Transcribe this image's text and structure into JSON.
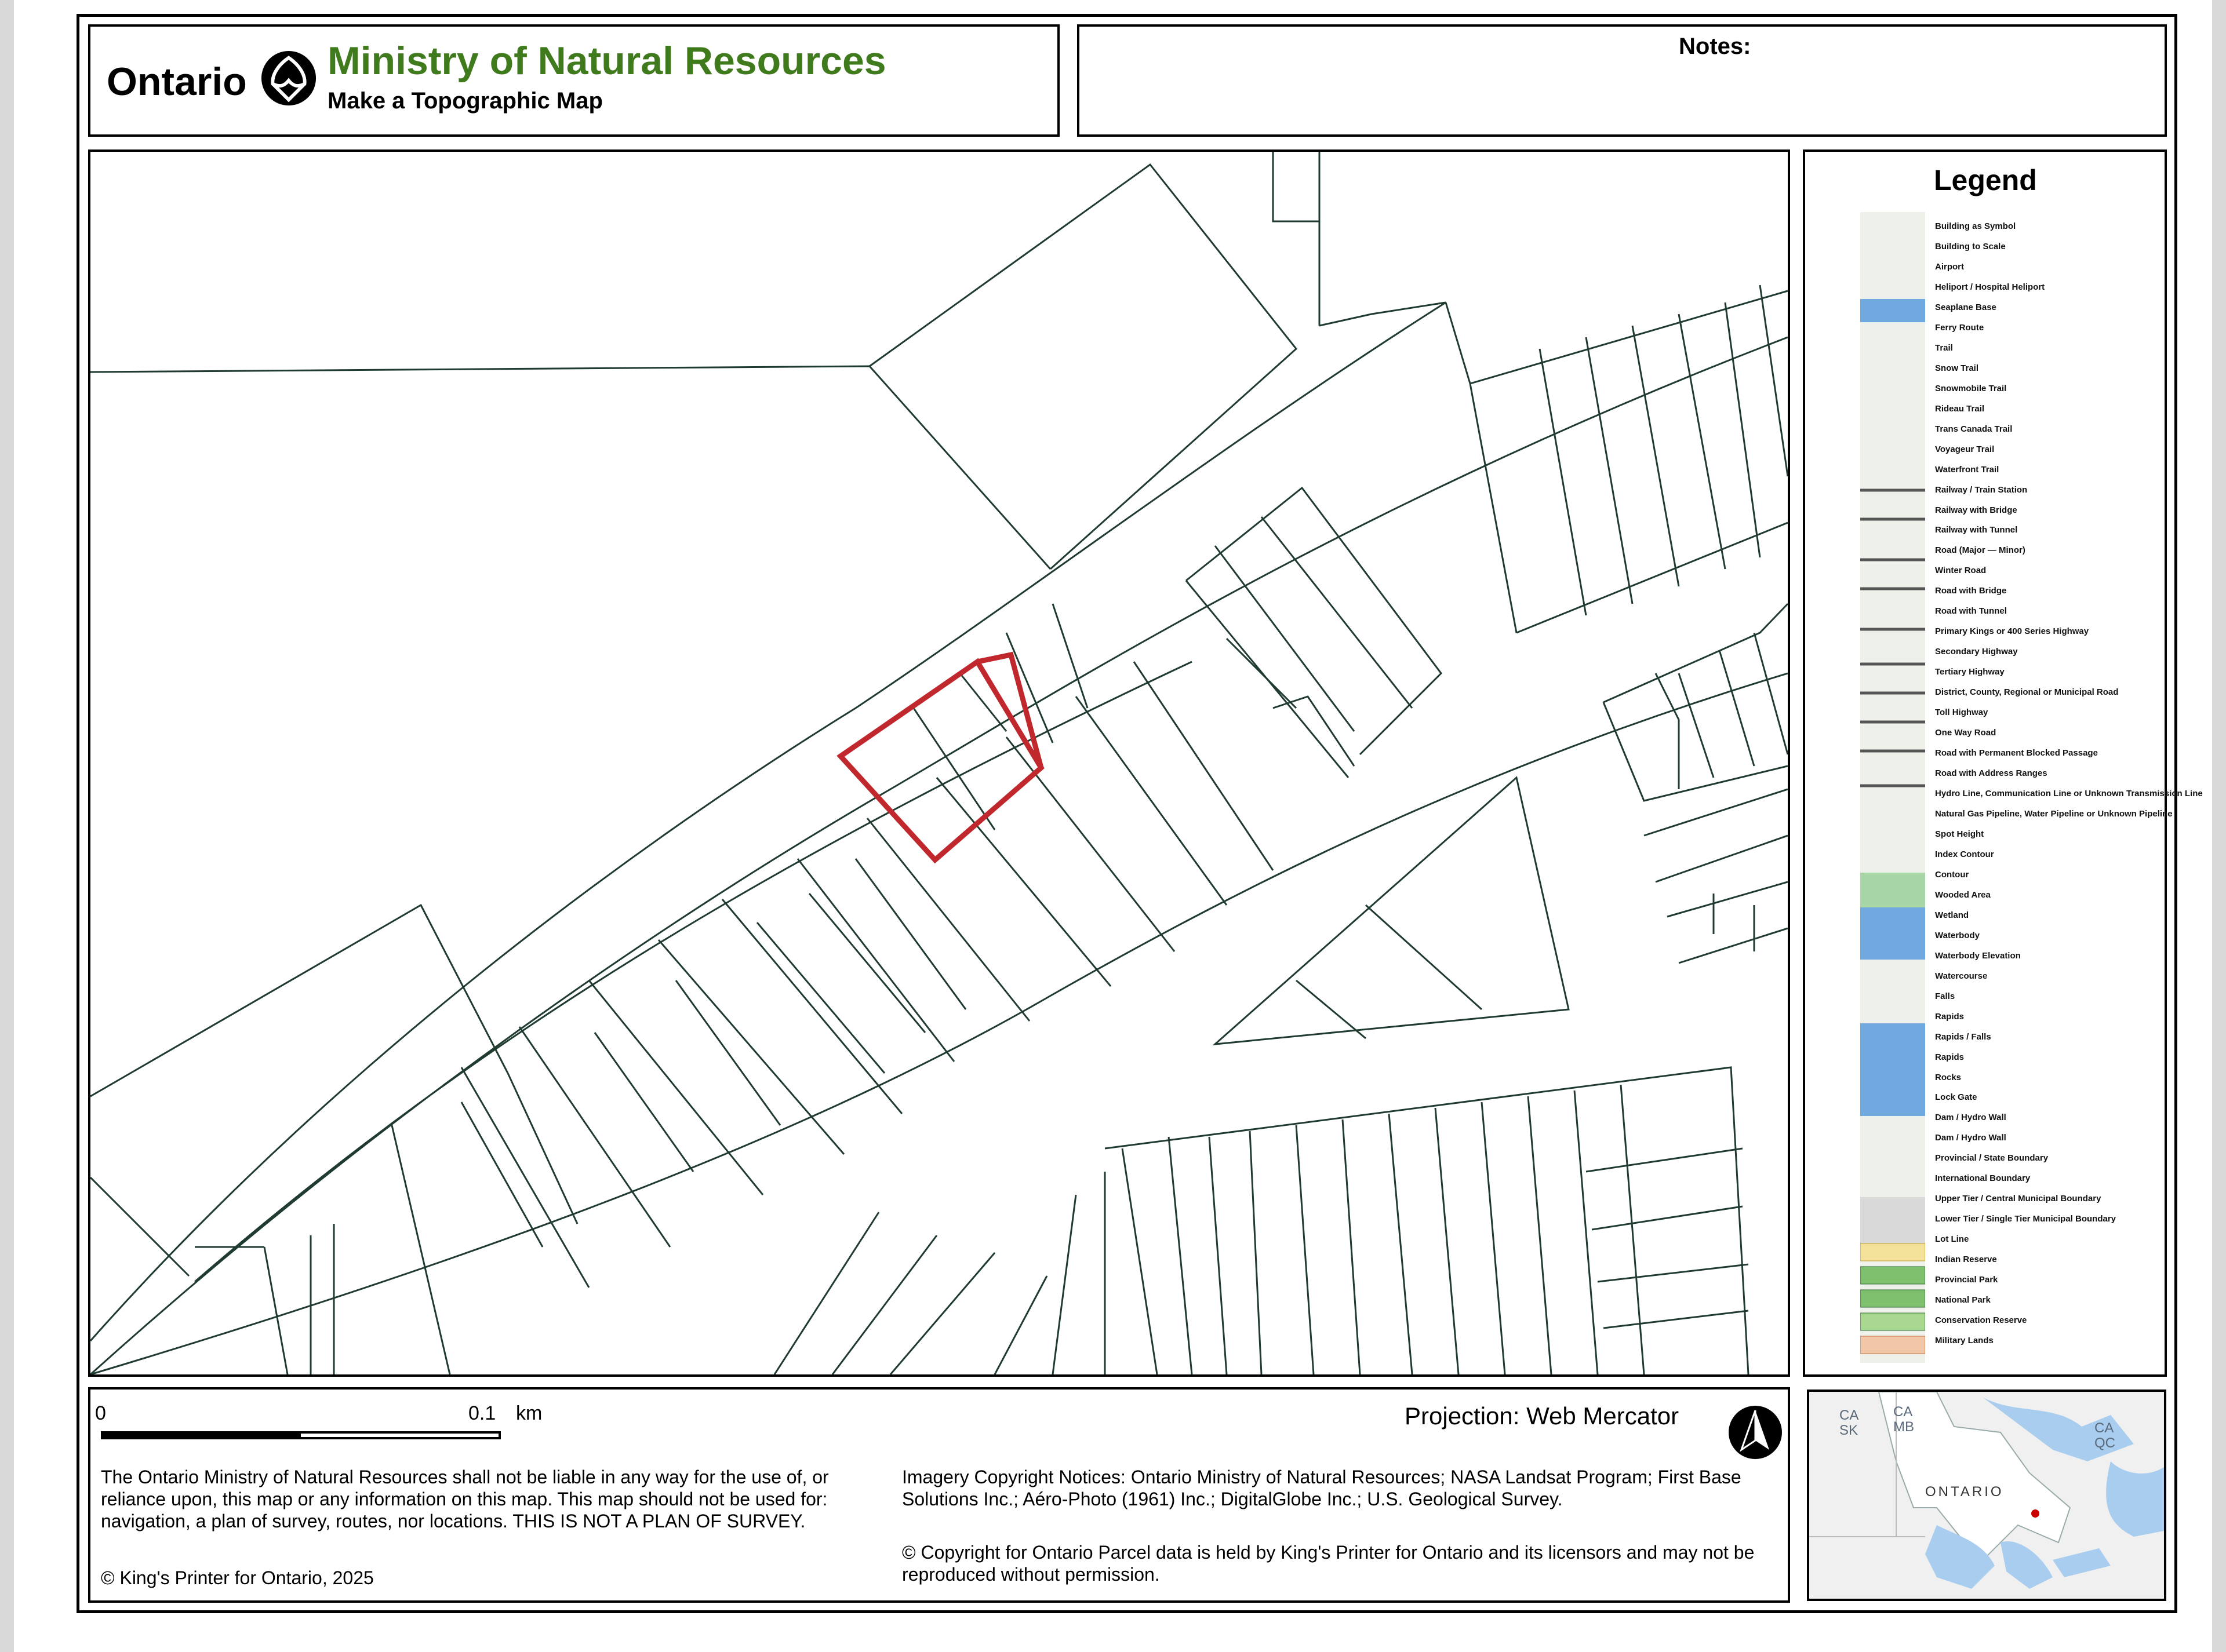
{
  "header": {
    "logo_word": "Ontario",
    "ministry": "Ministry of Natural Resources",
    "subtitle": "Make a Topographic Map"
  },
  "notes_label": "Notes:",
  "legend": {
    "title": "Legend",
    "items": [
      "Building as Symbol",
      "Building to Scale",
      "Airport",
      "Heliport / Hospital Heliport",
      "Seaplane Base",
      "Ferry Route",
      "Trail",
      "Snow Trail",
      "Snowmobile Trail",
      "Rideau Trail",
      "Trans Canada Trail",
      "Voyageur Trail",
      "Waterfront Trail",
      "Railway / Train Station",
      "Railway with Bridge",
      "Railway with Tunnel",
      "Road (Major — Minor)",
      "Winter Road",
      "Road with Bridge",
      "Road with Tunnel",
      "Primary Kings or 400 Series Highway",
      "Secondary Highway",
      "Tertiary Highway",
      "District, County, Regional or Municipal Road",
      "Toll Highway",
      "One Way Road",
      "Road with Permanent Blocked Passage",
      "Road with Address Ranges",
      "Hydro Line, Communication Line or Unknown Transmission Line",
      "Natural Gas Pipeline, Water Pipeline or Unknown Pipeline",
      "Spot Height",
      "Index Contour",
      "Contour",
      "Wooded Area",
      "Wetland",
      "Waterbody",
      "Waterbody Elevation",
      "Watercourse",
      "Falls",
      "Rapids",
      "Rapids / Falls",
      "Rapids",
      "Rocks",
      "Lock Gate",
      "Dam / Hydro Wall",
      "Dam / Hydro Wall",
      "Provincial / State Boundary",
      "International Boundary",
      "Upper Tier / Central Municipal Boundary",
      "Lower Tier / Single Tier Municipal Boundary",
      "Lot Line",
      "Indian Reserve",
      "Provincial Park",
      "National Park",
      "Conservation Reserve",
      "Military Lands"
    ]
  },
  "scale": {
    "zero": "0",
    "value": "0.1",
    "unit": "km"
  },
  "disclaimer": "The Ontario Ministry of Natural Resources shall not be liable in any way for the use of, or reliance upon, this map or any information on this map.  This map should not be used for: navigation, a plan of survey, routes, nor locations. THIS IS NOT A PLAN OF SURVEY.",
  "copyright_kings": "© King's Printer for Ontario,  2025",
  "projection": "Projection: Web Mercator",
  "imagery_notice": "Imagery Copyright Notices: Ontario Ministry of Natural Resources; NASA Landsat Program; First Base Solutions Inc.; Aéro-Photo (1961) Inc.; DigitalGlobe Inc.; U.S. Geological Survey.",
  "parcel_notice": "© Copyright for Ontario Parcel data is held by King's Printer for Ontario and its licensors and may not be reproduced without permission.",
  "inset": {
    "labels": {
      "ca_sk": "CA\nSK",
      "ca_mb": "CA\nMB",
      "ca_qc": "CA\nQC",
      "ontario": "ONTARIO"
    },
    "marker_color": "#cc0000"
  },
  "map": {
    "highlight_color": "#c0282d",
    "parcel_line_color": "#1f3a2e"
  }
}
